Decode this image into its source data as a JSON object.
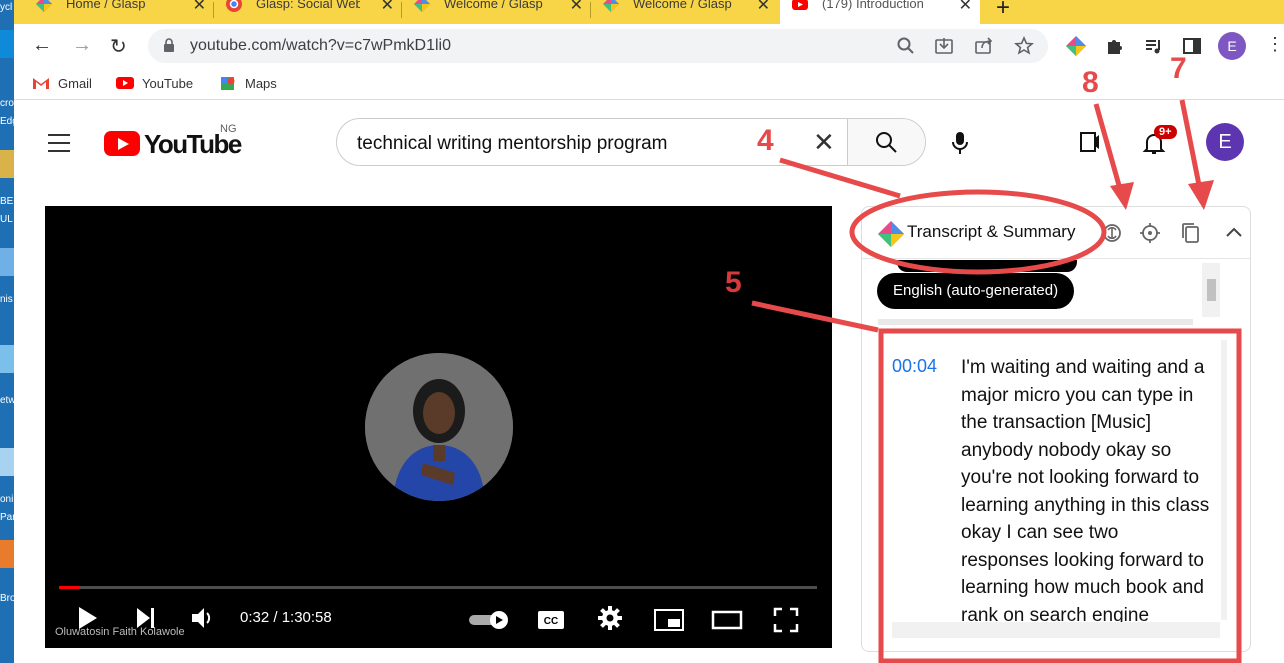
{
  "browser": {
    "tabs": [
      {
        "title": "Home / Glasp",
        "active": false
      },
      {
        "title": "Glasp: Social Web",
        "active": false
      },
      {
        "title": "Welcome / Glasp",
        "active": false
      },
      {
        "title": "Welcome / Glasp",
        "active": false
      },
      {
        "title": "(179) Introduction",
        "active": true
      }
    ],
    "new_tab": "+",
    "url": "youtube.com/watch?v=c7wPmkD1li0",
    "bookmarks": [
      "Gmail",
      "YouTube",
      "Maps"
    ],
    "profile_initial": "E"
  },
  "desktop": {
    "labels": [
      "ycl",
      "cro",
      "Edg",
      "BE",
      "UL",
      "nis",
      "etw",
      "oni",
      "Par",
      "Bro"
    ]
  },
  "youtube": {
    "logo_text": "YouTube",
    "country_code": "NG",
    "search_query": "technical writing mentorship program",
    "notification_badge": "9+",
    "avatar_initial": "E"
  },
  "player": {
    "time_current": "0:32",
    "time_total": "1:30:58",
    "time_display": "0:32 / 1:30:58",
    "channel_watermark": "Oluwatosin Faith Kolawole",
    "progress_fraction": 0.006
  },
  "glasp_panel": {
    "title": "Transcript & Summary",
    "language_button": "English (auto-generated)",
    "transcript": [
      {
        "time": "00:04",
        "text": "I'm waiting and waiting and a major micro you can type in the transaction [Music] anybody nobody okay so you're not looking forward to learning anything in this class okay I can see two responses looking forward to learning how much book and rank on search engine"
      }
    ]
  },
  "annotations": {
    "labels": [
      "4",
      "5",
      "7",
      "8"
    ],
    "color": "#e64a4a"
  },
  "colors": {
    "tab_strip": "#f7d547",
    "youtube_red": "#ff0000",
    "timestamp_blue": "#1a73e8",
    "annotation_red": "#e64a4a"
  }
}
